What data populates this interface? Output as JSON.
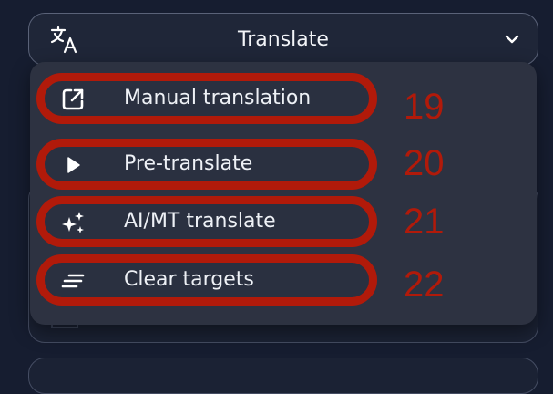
{
  "header": {
    "label": "Translate",
    "icon": "translate-icon",
    "dropdown_icon": "chevron-down-icon"
  },
  "menu": {
    "items": [
      {
        "label": "Manual translation",
        "icon": "external-link-icon",
        "step": "19"
      },
      {
        "label": "Pre-translate",
        "icon": "play-icon",
        "step": "20"
      },
      {
        "label": "AI/MT translate",
        "icon": "sparkles-icon",
        "step": "21"
      },
      {
        "label": "Clear targets",
        "icon": "clear-lines-icon",
        "step": "22"
      }
    ]
  },
  "colors": {
    "background": "#161d30",
    "menu_background": "#2d3241",
    "highlight": "#b11a0a",
    "text": "#eef1f6"
  }
}
